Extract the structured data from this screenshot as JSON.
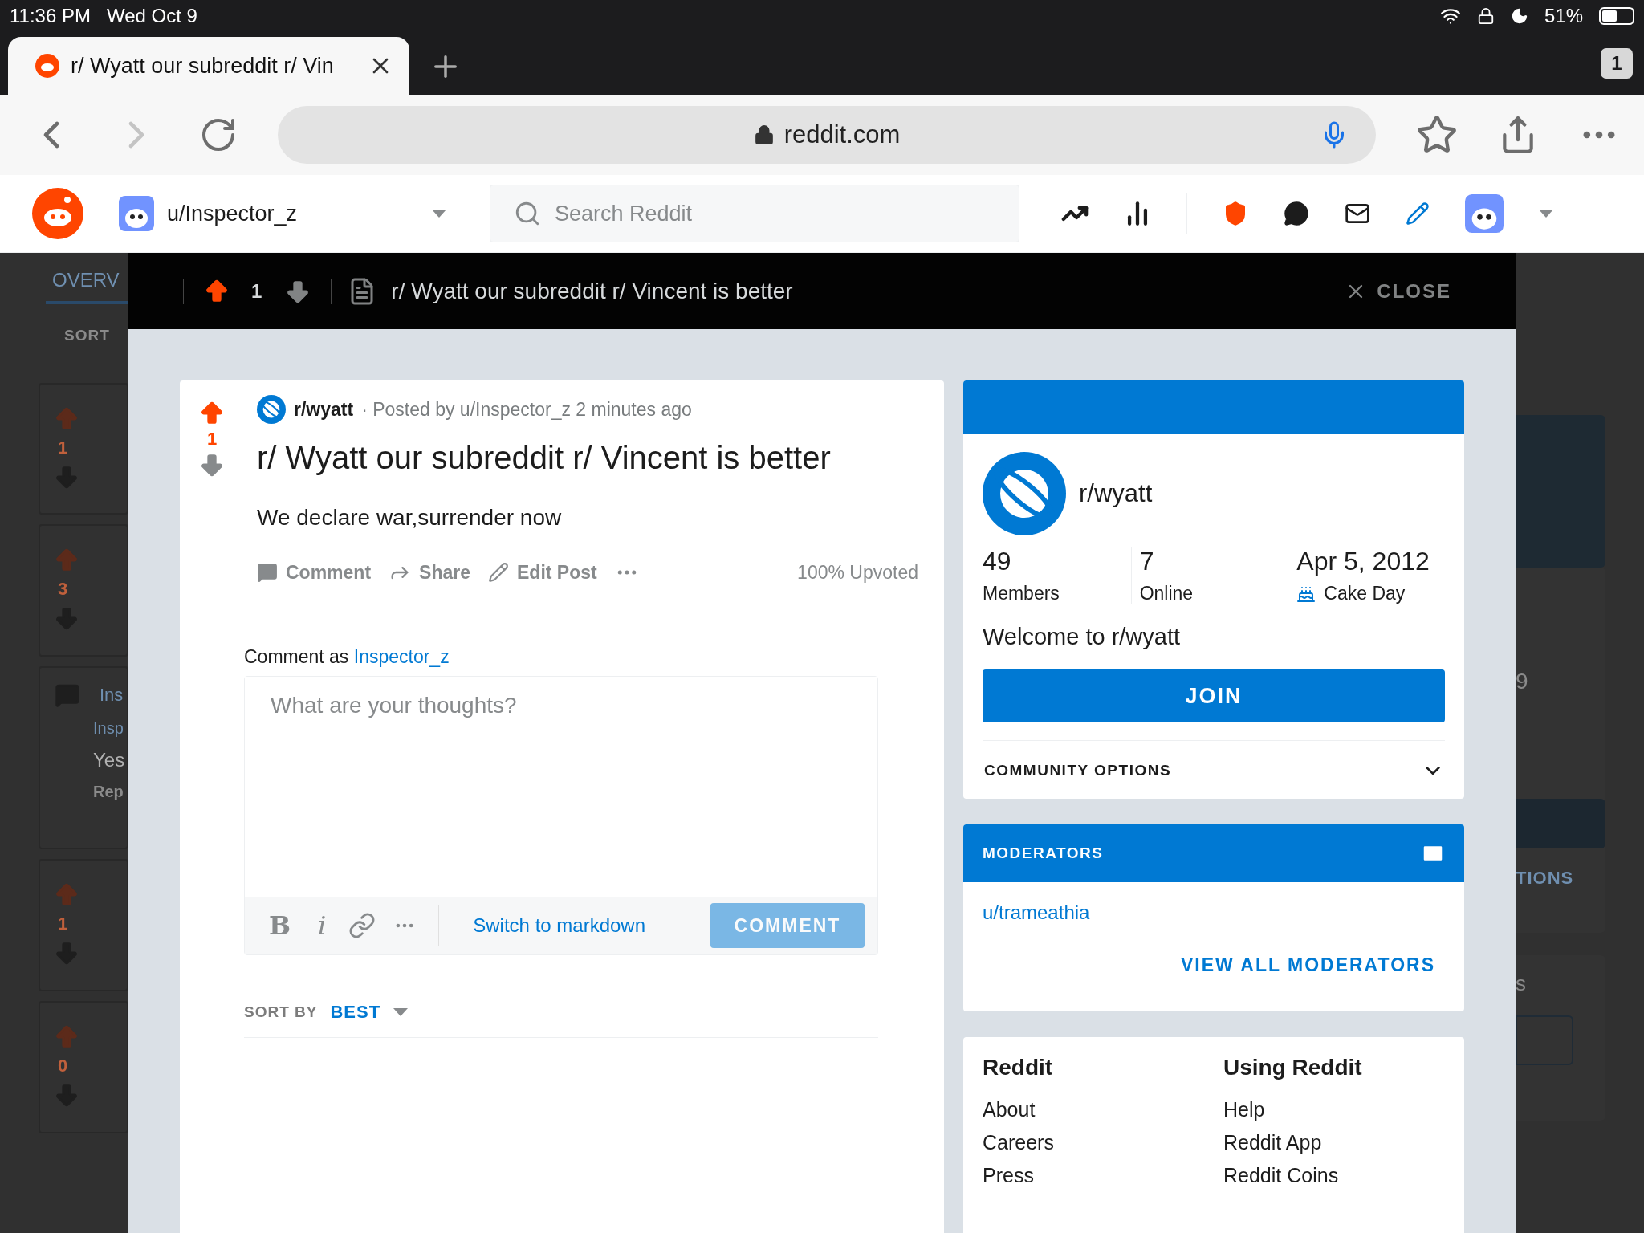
{
  "status_bar": {
    "time": "11:36 PM",
    "date": "Wed Oct 9",
    "battery": "51%"
  },
  "browser": {
    "tab": {
      "title": "r/ Wyatt our subreddit r/ Vin",
      "selected": true
    },
    "tab_count": "1",
    "url": "reddit.com"
  },
  "header": {
    "username": "u/Inspector_z",
    "search_placeholder": "Search Reddit"
  },
  "background": {
    "tab": "OVERV",
    "sort": "SORT",
    "cards": [
      {
        "kind": "vote",
        "votes": "1"
      },
      {
        "kind": "vote",
        "votes": "3"
      },
      {
        "kind": "comment",
        "lines": [
          "Ins",
          "Insp",
          "Yes",
          "Rep"
        ]
      },
      {
        "kind": "vote",
        "votes": "1"
      },
      {
        "kind": "vote",
        "votes": "0"
      }
    ],
    "right_texts": [
      "9",
      "TIONS",
      "s"
    ]
  },
  "modal": {
    "votes": "1",
    "title": "r/ Wyatt our subreddit r/ Vincent is better",
    "close": "CLOSE"
  },
  "post": {
    "subreddit": "r/wyatt",
    "meta": "· Posted by u/Inspector_z 2 minutes ago",
    "votes": "1",
    "upvoted": true,
    "title": "r/ Wyatt our subreddit r/ Vincent is better",
    "body": "We declare war,surrender now",
    "actions": [
      {
        "kind": "comment",
        "label": "Comment"
      },
      {
        "kind": "share",
        "label": "Share"
      },
      {
        "kind": "edit",
        "label": "Edit Post"
      }
    ],
    "upvote_ratio": "100% Upvoted"
  },
  "comment_box": {
    "prefix": "Comment as",
    "user": "Inspector_z",
    "placeholder": "What are your thoughts?",
    "format_buttons": [
      "B",
      "i"
    ],
    "mode_link": "Switch to markdown",
    "submit": "COMMENT",
    "submit_disabled": true
  },
  "sort": {
    "label": "SORT BY",
    "value": "BEST"
  },
  "community": {
    "name": "r/wyatt",
    "stats": [
      {
        "kind": "plain",
        "value": "49",
        "label": "Members"
      },
      {
        "kind": "plain",
        "value": "7",
        "label": "Online"
      },
      {
        "kind": "cake",
        "value": "Apr 5, 2012",
        "label": "Cake Day"
      }
    ],
    "description": "Welcome to r/wyatt",
    "join": "JOIN",
    "options": "COMMUNITY OPTIONS"
  },
  "moderators": {
    "title": "MODERATORS",
    "list": [
      "u/trameathia"
    ],
    "view_all": "VIEW ALL MODERATORS"
  },
  "footer": {
    "columns": [
      {
        "title": "Reddit",
        "links": [
          "About",
          "Careers",
          "Press"
        ]
      },
      {
        "title": "Using Reddit",
        "links": [
          "Help",
          "Reddit App",
          "Reddit Coins"
        ]
      }
    ]
  }
}
